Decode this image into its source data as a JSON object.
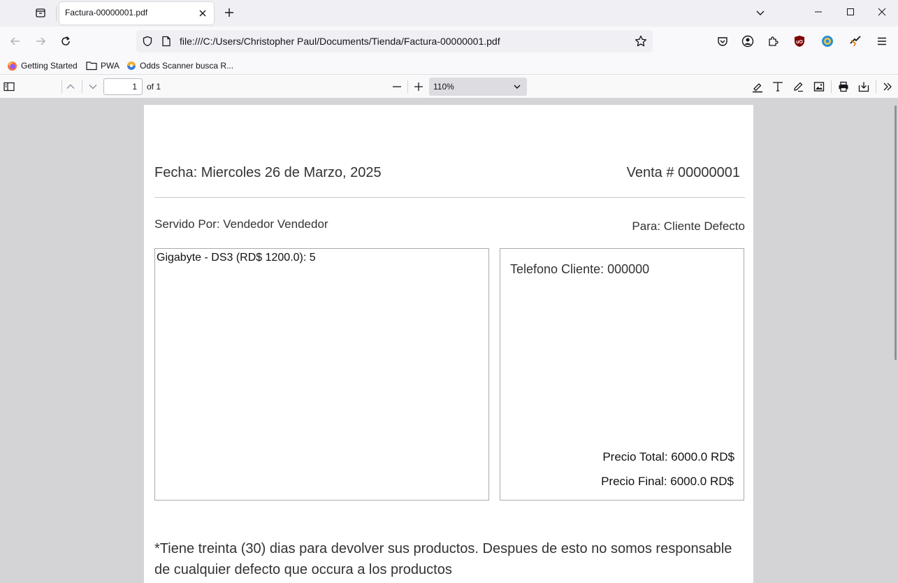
{
  "browser": {
    "tab": {
      "title": "Factura-00000001.pdf"
    },
    "address": {
      "url": "file:///C:/Users/Christopher Paul/Documents/Tienda/Factura-00000001.pdf"
    },
    "bookmarks": [
      {
        "label": "Getting Started",
        "icon": "firefox-icon"
      },
      {
        "label": "PWA",
        "icon": "folder-icon"
      },
      {
        "label": "Odds Scanner busca R...",
        "icon": "site-icon"
      }
    ]
  },
  "pdf_toolbar": {
    "page_number": "1",
    "page_count_label": "of 1",
    "zoom": "110%"
  },
  "invoice": {
    "fecha": "Fecha: Miercoles 26 de Marzo, 2025",
    "venta": "Venta # 00000001",
    "servido_por": "Servido Por: Vendedor Vendedor",
    "para": "Para: Cliente Defecto",
    "items": [
      "Gigabyte - DS3 (RD$ 1200.0): 5"
    ],
    "telefono": "Telefono Cliente: 000000",
    "precio_total": "Precio Total: 6000.0 RD$",
    "precio_final": "Precio Final: 6000.0 RD$",
    "nota": "*Tiene treinta (30) dias para devolver sus productos. Despues de esto no somos responsable de cualquier defecto que occura a los productos"
  },
  "colors": {
    "tab_strip": "#f0f0f4",
    "toolbar": "#f9f9fb",
    "viewer_bg": "#d4d4d7",
    "ublock_red": "#800000"
  }
}
